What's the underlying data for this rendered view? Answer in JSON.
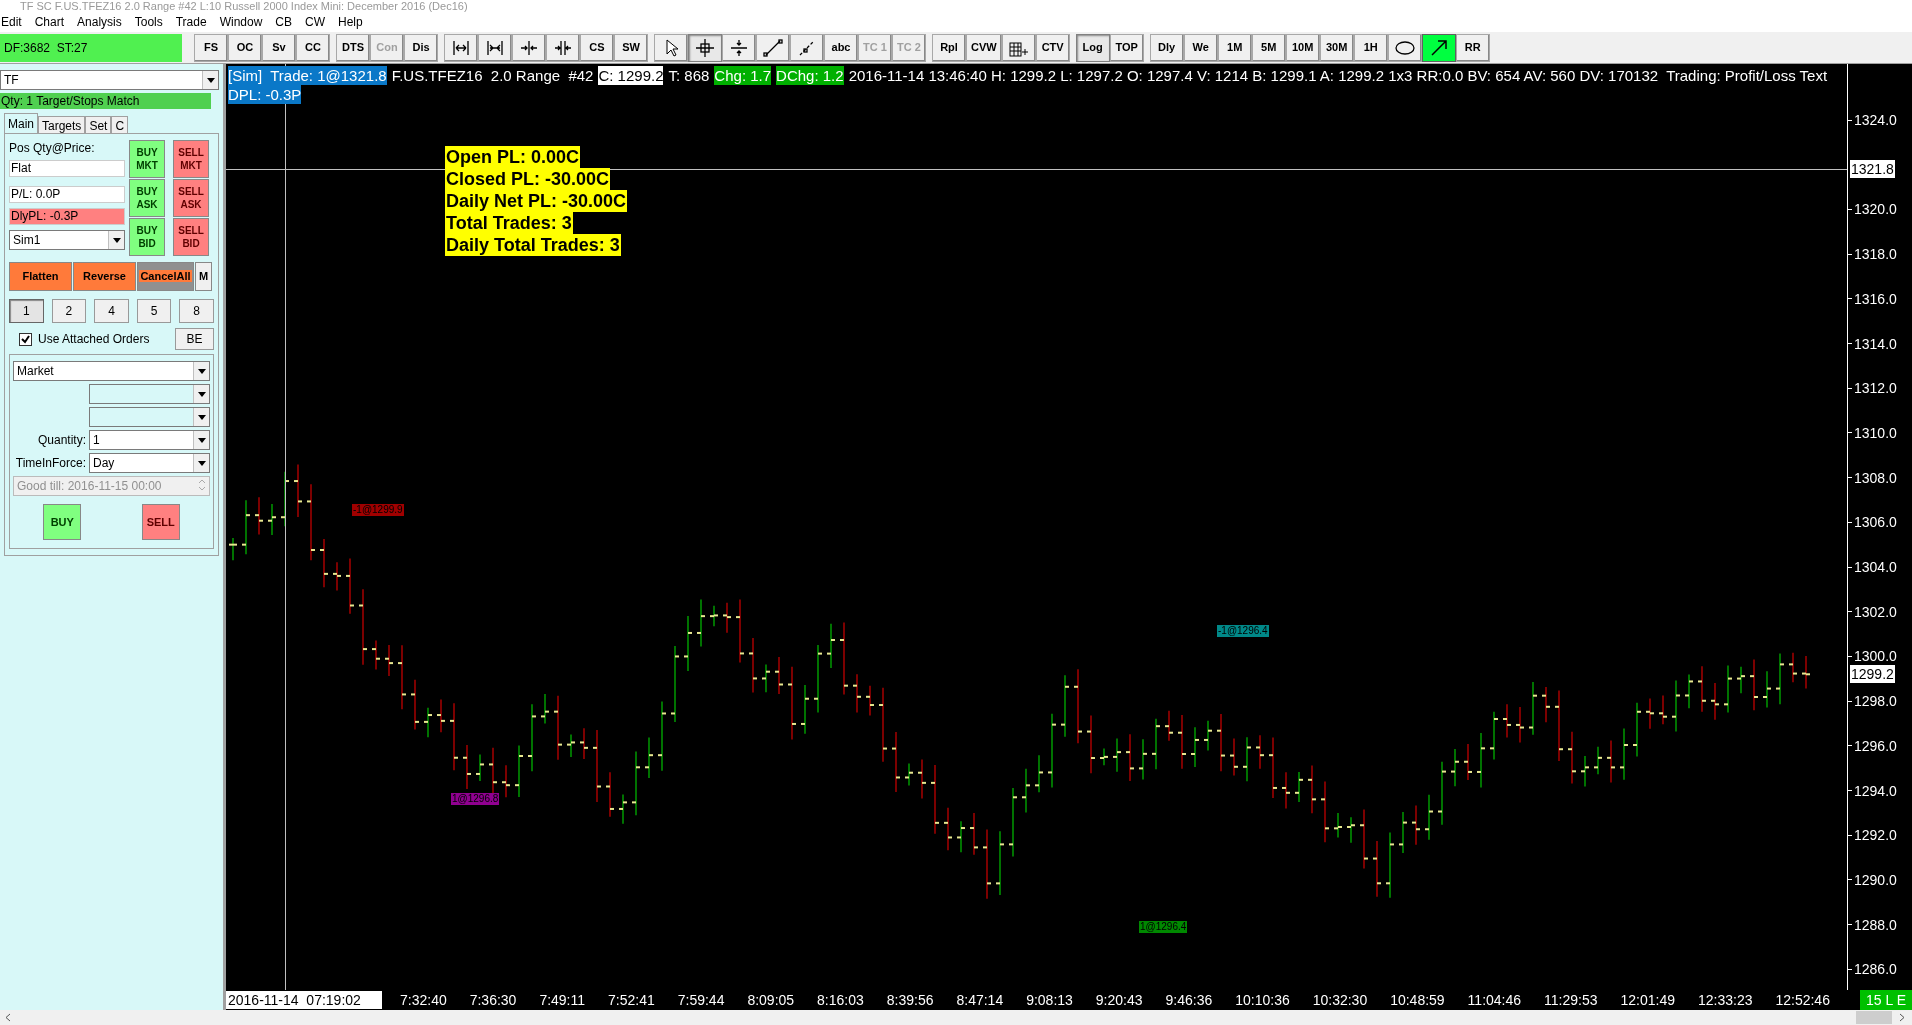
{
  "window": {
    "title": "TF  SC F.US.TFEZ16  2.0 Range  #42  L:10  Russell 2000 Index Mini: December 2016 (Dec16)"
  },
  "menu": [
    "Edit",
    "Chart",
    "Analysis",
    "Tools",
    "Trade",
    "Window",
    "CB",
    "CW",
    "Help"
  ],
  "toolbar": {
    "status": "DF:3682  ST:27",
    "groups": [
      [
        {
          "kind": "text",
          "label": "FS",
          "disabled": false,
          "selected": false
        },
        {
          "kind": "text",
          "label": "OC",
          "disabled": false,
          "selected": false
        },
        {
          "kind": "text",
          "label": "Sv",
          "disabled": false,
          "selected": false
        },
        {
          "kind": "text",
          "label": "CC",
          "disabled": false,
          "selected": false
        }
      ],
      [
        {
          "kind": "text",
          "label": "DTS",
          "disabled": false,
          "selected": false
        },
        {
          "kind": "text",
          "label": "Con",
          "disabled": true,
          "selected": false
        },
        {
          "kind": "text",
          "label": "Dis",
          "disabled": false,
          "selected": false
        }
      ],
      [
        {
          "kind": "icon",
          "selected": false
        },
        {
          "kind": "icon",
          "selected": false
        },
        {
          "kind": "icon",
          "selected": false
        },
        {
          "kind": "icon",
          "selected": false
        },
        {
          "kind": "text",
          "label": "CS",
          "disabled": false,
          "selected": false
        },
        {
          "kind": "text",
          "label": "SW",
          "disabled": false,
          "selected": false
        }
      ],
      [
        {
          "kind": "icon",
          "selected": false
        },
        {
          "kind": "icon",
          "selected": true
        },
        {
          "kind": "icon",
          "selected": false
        },
        {
          "kind": "icon",
          "selected": false
        },
        {
          "kind": "icon",
          "selected": false
        },
        {
          "kind": "text",
          "label": "abc",
          "disabled": false,
          "selected": false
        },
        {
          "kind": "text",
          "label": "TC 1",
          "disabled": true,
          "selected": false
        },
        {
          "kind": "text",
          "label": "TC 2",
          "disabled": true,
          "selected": false
        }
      ],
      [
        {
          "kind": "text",
          "label": "Rpl",
          "disabled": false,
          "selected": false
        },
        {
          "kind": "text",
          "label": "CVW",
          "disabled": false,
          "selected": false
        },
        {
          "kind": "icon",
          "selected": false
        },
        {
          "kind": "text",
          "label": "CTV",
          "disabled": false,
          "selected": false
        }
      ],
      [
        {
          "kind": "text",
          "label": "Log",
          "disabled": false,
          "selected": true
        },
        {
          "kind": "text",
          "label": "TOP",
          "disabled": false,
          "selected": false
        }
      ],
      [
        {
          "kind": "text",
          "label": "Dly",
          "disabled": false,
          "selected": false
        },
        {
          "kind": "text",
          "label": "We",
          "disabled": false,
          "selected": false
        },
        {
          "kind": "text",
          "label": "1M",
          "disabled": false,
          "selected": false
        },
        {
          "kind": "text",
          "label": "5M",
          "disabled": false,
          "selected": false
        },
        {
          "kind": "text",
          "label": "10M",
          "disabled": false,
          "selected": false
        },
        {
          "kind": "text",
          "label": "30M",
          "disabled": false,
          "selected": false
        },
        {
          "kind": "text",
          "label": "1H",
          "disabled": false,
          "selected": false
        },
        {
          "kind": "icon",
          "selected": false
        },
        {
          "kind": "icon",
          "selected": true
        },
        {
          "kind": "text",
          "label": "RR",
          "disabled": false,
          "selected": false
        }
      ]
    ]
  },
  "trade_panel": {
    "symbol": "TF",
    "status": "Qty: 1 Target/Stops Match",
    "tabs": [
      {
        "label": "Main",
        "selected": true
      },
      {
        "label": "Targets",
        "selected": false
      },
      {
        "label": "Set",
        "selected": false
      },
      {
        "label": "C",
        "selected": false
      }
    ],
    "position_label": "Pos Qty@Price:",
    "position": "Flat",
    "pl": "P/L: 0.0P",
    "daily_pl": "DlyPL: -0.3P",
    "account": "Sim1",
    "order_buttons": [
      {
        "kind": "buy",
        "label": "BUY\nMKT"
      },
      {
        "kind": "sell",
        "label": "SELL\nMKT"
      },
      {
        "kind": "buy",
        "label": "BUY\nASK"
      },
      {
        "kind": "sell",
        "label": "SELL\nASK"
      },
      {
        "kind": "buy",
        "label": "BUY\nBID"
      },
      {
        "kind": "sell",
        "label": "SELL\nBID"
      }
    ],
    "actions": [
      {
        "kind": "action",
        "label": "Flatten"
      },
      {
        "kind": "action",
        "label": "Reverse"
      },
      {
        "kind": "cancel",
        "label": "CancelAll"
      },
      {
        "kind": "plain",
        "label": "M"
      }
    ],
    "quantities": [
      {
        "label": "1",
        "selected": true
      },
      {
        "label": "2",
        "selected": false
      },
      {
        "label": "4",
        "selected": false
      },
      {
        "label": "5",
        "selected": false
      },
      {
        "label": "8",
        "selected": false
      }
    ],
    "attached_orders": {
      "label": "Use Attached Orders",
      "checked": true
    },
    "be": "BE",
    "order_type": "Market",
    "quantity_label": "Quantity:",
    "quantity": "1",
    "tif_label": "TimeInForce:",
    "tif": "Day",
    "good_till": "Good till: 2016-11-15 00:00",
    "buy": "BUY",
    "sell": "SELL"
  },
  "chart": {
    "header": [
      {
        "kind": "sim",
        "text": "[Sim]  Trade: 1@1321.8"
      },
      {
        "kind": "plain",
        "text": "F.US.TFEZ16  2.0 Range  #42"
      },
      {
        "kind": "close",
        "text": "C: 1299.2"
      },
      {
        "kind": "plain",
        "text": "T: 868"
      },
      {
        "kind": "change",
        "text": "Chg: 1.7"
      },
      {
        "kind": "change",
        "text": "DChg: 1.2"
      },
      {
        "kind": "plain",
        "text": "2016-11-14 13:46:40 H: 1299.2 L: 1297.2 O: 1297.4 V: 1214 B: 1299.1 A: 1299.2 1x3 RR:0.0 BV: 654 AV: 560 DV: 170132  Trading: Profit/Loss Text"
      }
    ],
    "dpl": "DPL: -0.3P",
    "pl_text": [
      "Open PL: 0.00C",
      "Closed PL: -30.00C",
      "Daily Net PL: -30.00C",
      "Total Trades: 3",
      "Daily Total Trades: 3"
    ],
    "fills": [
      {
        "text": "-1@1299.9",
        "color": "#a00000"
      },
      {
        "text": "1@1296.8",
        "color": "#900090"
      },
      {
        "text": "-1@1296.4",
        "color": "#008888"
      },
      {
        "text": "1@1296.4",
        "color": "#008800"
      }
    ],
    "price_labels": [
      "1324.0",
      "1320.0",
      "1318.0",
      "1316.0",
      "1314.0",
      "1312.0",
      "1310.0",
      "1308.0",
      "1306.0",
      "1304.0",
      "1302.0",
      "1300.0",
      "1298.0",
      "1296.0",
      "1294.0",
      "1292.0",
      "1290.0",
      "1288.0",
      "1286.0"
    ],
    "cursor_price": "1321.8",
    "last_price": "1299.2",
    "cursor_time": "2016-11-14  07:19:02",
    "time_labels": [
      "7:32:40",
      "7:36:30",
      "7:49:11",
      "7:52:41",
      "7:59:44",
      "8:09:05",
      "8:16:03",
      "8:39:56",
      "8:47:14",
      "9:08:13",
      "9:20:43",
      "9:46:36",
      "10:10:36",
      "10:32:30",
      "10:48:59",
      "11:04:46",
      "11:29:53",
      "12:01:49",
      "12:33:23",
      "12:52:46"
    ],
    "corner": "15 L E"
  }
}
